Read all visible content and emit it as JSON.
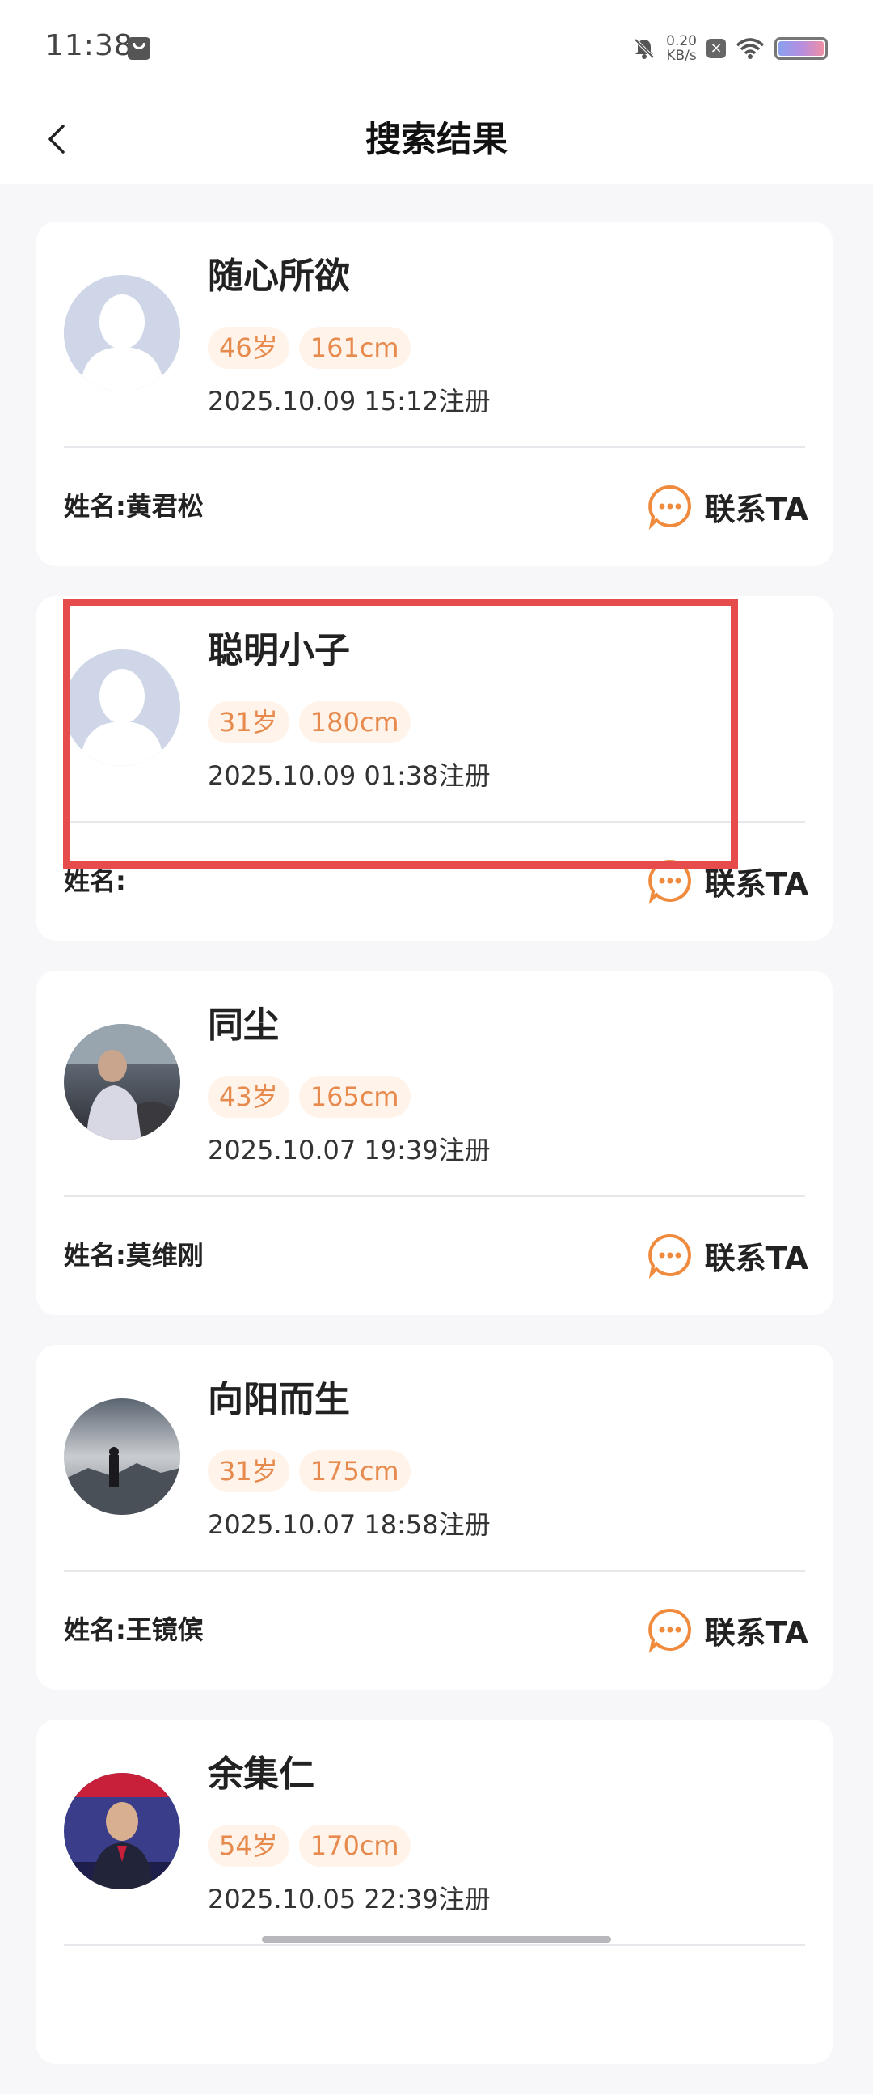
{
  "status_bar": {
    "time": "11:38",
    "net_speed_value": "0.20",
    "net_speed_unit": "KB/s"
  },
  "header": {
    "title": "搜索结果"
  },
  "colors": {
    "tag_text": "#e68a4d",
    "tag_bg": "#fff3ea",
    "accent": "#f08a3c",
    "highlight": "#e74c4c"
  },
  "cards": [
    {
      "name": "随心所欲",
      "age": "46岁",
      "height": "161cm",
      "registered": "2025.10.09 15:12注册",
      "real_name": "姓名:黄君松",
      "contact_label": "联系TA",
      "avatar": "default-silhouette"
    },
    {
      "name": "聪明小子",
      "age": "31岁",
      "height": "180cm",
      "registered": "2025.10.09 01:38注册",
      "real_name": "姓名:",
      "contact_label": "联系TA",
      "avatar": "default-silhouette"
    },
    {
      "name": "同尘",
      "age": "43岁",
      "height": "165cm",
      "registered": "2025.10.07 19:39注册",
      "real_name": "姓名:莫维刚",
      "contact_label": "联系TA",
      "avatar": "photo-car-driver"
    },
    {
      "name": "向阳而生",
      "age": "31岁",
      "height": "175cm",
      "registered": "2025.10.07 18:58注册",
      "real_name": "姓名:王镜傧",
      "contact_label": "联系TA",
      "avatar": "photo-mountain-sky"
    },
    {
      "name": "余集仁",
      "age": "54岁",
      "height": "170cm",
      "registered": "2025.10.05 22:39注册",
      "real_name": "",
      "contact_label": "",
      "avatar": "photo-man-red-banner"
    }
  ]
}
